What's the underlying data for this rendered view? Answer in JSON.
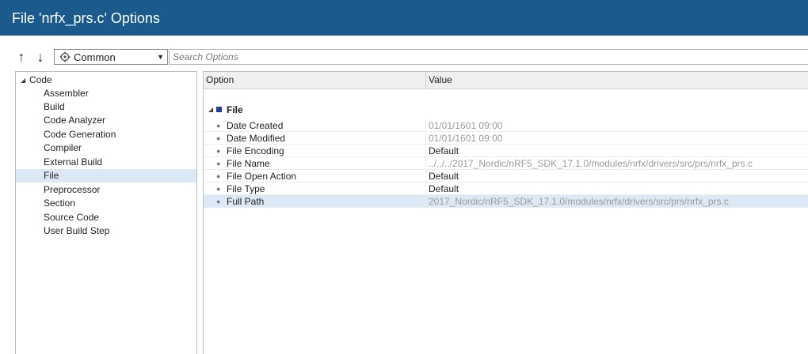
{
  "window": {
    "title": "File 'nrfx_prs.c' Options"
  },
  "toolbar": {
    "up_icon": "arrow-up-icon",
    "down_icon": "arrow-down-icon",
    "category_icon": "gear-icon",
    "category_label": "Common",
    "search_placeholder": "Search Options"
  },
  "tree": {
    "root": "Code",
    "children": [
      "Assembler",
      "Build",
      "Code Analyzer",
      "Code Generation",
      "Compiler",
      "External Build",
      "File",
      "Preprocessor",
      "Section",
      "Source Code",
      "User Build Step"
    ],
    "selected": "File"
  },
  "grid": {
    "header": {
      "option": "Option",
      "value": "Value"
    },
    "category": "File",
    "properties": [
      {
        "name": "Date Created",
        "value": "01/01/1601 09:00",
        "muted": true
      },
      {
        "name": "Date Modified",
        "value": "01/01/1601 09:00",
        "muted": true
      },
      {
        "name": "File Encoding",
        "value": "Default",
        "muted": false
      },
      {
        "name": "File Name",
        "value": "../../../2017_Nordic/nRF5_SDK_17.1.0/modules/nrfx/drivers/src/prs/nrfx_prs.c",
        "muted": true
      },
      {
        "name": "File Open Action",
        "value": "Default",
        "muted": false
      },
      {
        "name": "File Type",
        "value": "Default",
        "muted": false
      },
      {
        "name": "Full Path",
        "value": "2017_Nordic/nRF5_SDK_17.1.0/modules/nrfx/drivers/src/prs/nrfx_prs.c",
        "muted": true
      }
    ],
    "selected": "Full Path"
  },
  "colors": {
    "titlebar": "#1a5a8c",
    "selection": "#dde8f6",
    "category_square": "#1f3f9e",
    "muted_text": "#9a9a9a"
  }
}
